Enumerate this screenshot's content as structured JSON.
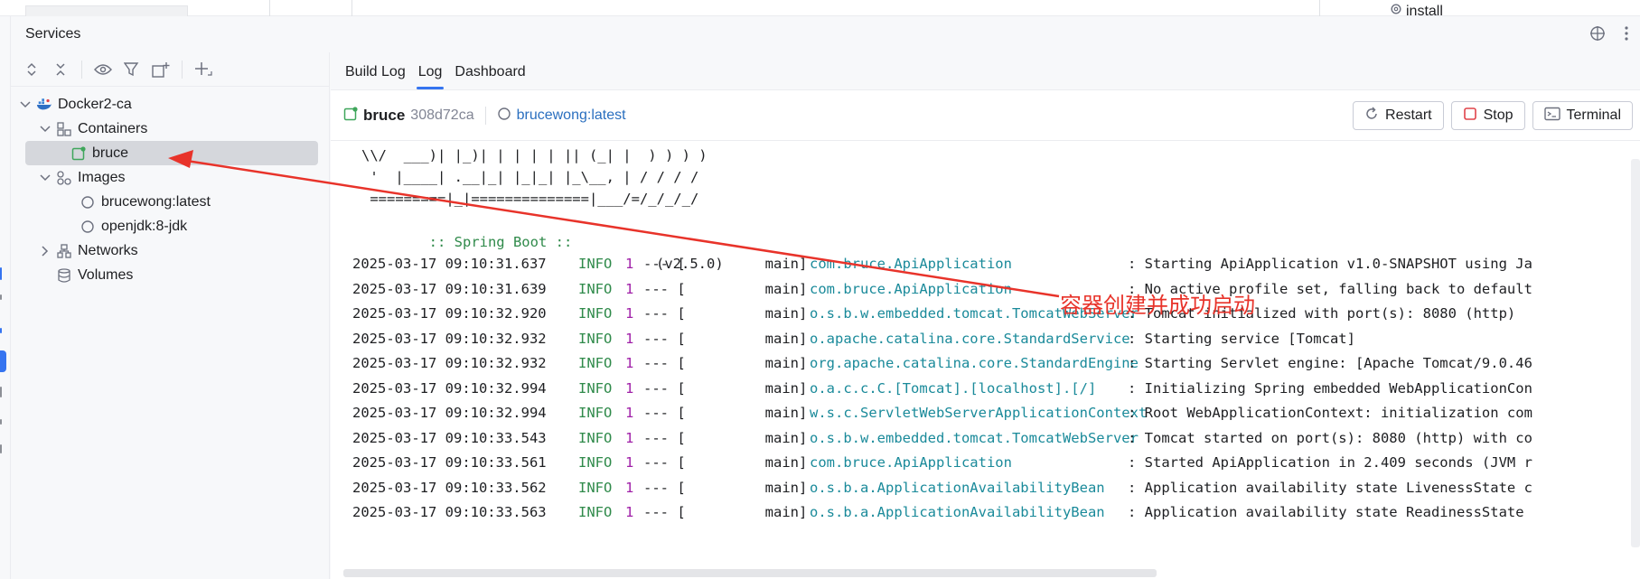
{
  "top": {
    "install_label": "install"
  },
  "services": {
    "title": "Services",
    "tree": {
      "items": [
        {
          "label": "Docker2-ca"
        },
        {
          "label": "Containers"
        },
        {
          "label": "bruce"
        },
        {
          "label": "Images"
        },
        {
          "label": "brucewong:latest"
        },
        {
          "label": "openjdk:8-jdk"
        },
        {
          "label": "Networks"
        },
        {
          "label": "Volumes"
        }
      ]
    },
    "tabs": [
      "Build Log",
      "Log",
      "Dashboard"
    ],
    "active_tab": "Log",
    "container": {
      "name": "bruce",
      "id": "308d72ca",
      "image": "brucewong:latest"
    },
    "actions": {
      "restart": "Restart",
      "stop": "Stop",
      "terminal": "Terminal"
    },
    "log": {
      "banner": [
        "\\\\/  ___)| |_)| | | | | || (_| |  ) ) ) )",
        " '  |____| .__|_| |_|_| |_\\__, | / / / /",
        " =========|_|==============|___/=/_/_/_/"
      ],
      "spring_label": ":: Spring Boot ::",
      "spring_version": "(v2.5.0)",
      "entries": [
        {
          "ts": "2025-03-17 09:10:31.637",
          "level": "INFO",
          "pid": "1",
          "sep": "--- [",
          "thread": "           main]",
          "logger": "com.bruce.ApiApplication",
          "msg": ": Starting ApiApplication v1.0-SNAPSHOT using Ja"
        },
        {
          "ts": "2025-03-17 09:10:31.639",
          "level": "INFO",
          "pid": "1",
          "sep": "--- [",
          "thread": "           main]",
          "logger": "com.bruce.ApiApplication",
          "msg": ": No active profile set, falling back to default"
        },
        {
          "ts": "2025-03-17 09:10:32.920",
          "level": "INFO",
          "pid": "1",
          "sep": "--- [",
          "thread": "           main]",
          "logger": "o.s.b.w.embedded.tomcat.TomcatWebServer",
          "msg": ": Tomcat initialized with port(s): 8080 (http)"
        },
        {
          "ts": "2025-03-17 09:10:32.932",
          "level": "INFO",
          "pid": "1",
          "sep": "--- [",
          "thread": "           main]",
          "logger": "o.apache.catalina.core.StandardService",
          "msg": ": Starting service [Tomcat]"
        },
        {
          "ts": "2025-03-17 09:10:32.932",
          "level": "INFO",
          "pid": "1",
          "sep": "--- [",
          "thread": "           main]",
          "logger": "org.apache.catalina.core.StandardEngine",
          "msg": ": Starting Servlet engine: [Apache Tomcat/9.0.46"
        },
        {
          "ts": "2025-03-17 09:10:32.994",
          "level": "INFO",
          "pid": "1",
          "sep": "--- [",
          "thread": "           main]",
          "logger": "o.a.c.c.C.[Tomcat].[localhost].[/]",
          "msg": ": Initializing Spring embedded WebApplicationCon"
        },
        {
          "ts": "2025-03-17 09:10:32.994",
          "level": "INFO",
          "pid": "1",
          "sep": "--- [",
          "thread": "           main]",
          "logger": "w.s.c.ServletWebServerApplicationContext",
          "msg": ": Root WebApplicationContext: initialization com"
        },
        {
          "ts": "2025-03-17 09:10:33.543",
          "level": "INFO",
          "pid": "1",
          "sep": "--- [",
          "thread": "           main]",
          "logger": "o.s.b.w.embedded.tomcat.TomcatWebServer",
          "msg": ": Tomcat started on port(s): 8080 (http) with co"
        },
        {
          "ts": "2025-03-17 09:10:33.561",
          "level": "INFO",
          "pid": "1",
          "sep": "--- [",
          "thread": "           main]",
          "logger": "com.bruce.ApiApplication",
          "msg": ": Started ApiApplication in 2.409 seconds (JVM r"
        },
        {
          "ts": "2025-03-17 09:10:33.562",
          "level": "INFO",
          "pid": "1",
          "sep": "--- [",
          "thread": "           main]",
          "logger": "o.s.b.a.ApplicationAvailabilityBean",
          "msg": ": Application availability state LivenessState c"
        },
        {
          "ts": "2025-03-17 09:10:33.563",
          "level": "INFO",
          "pid": "1",
          "sep": "--- [",
          "thread": "           main]",
          "logger": "o.s.b.a.ApplicationAvailabilityBean",
          "msg": ": Application availability state ReadinessState"
        }
      ]
    }
  },
  "annotation": {
    "text": "容器创建并成功启动",
    "color": "#e8332a"
  },
  "colors": {
    "accent": "#3574f0",
    "info": "#2f8a4a",
    "logger": "#1a8a9a",
    "pid": "#a020a8",
    "image_link": "#2a6fbf",
    "container_running": "#3fa65b",
    "stop_red": "#e0434a"
  }
}
